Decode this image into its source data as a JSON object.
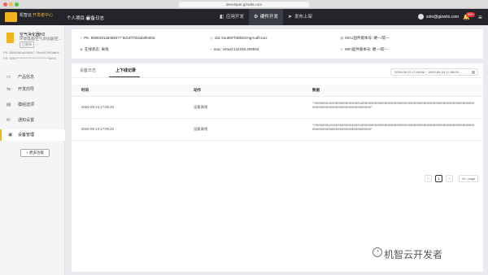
{
  "browser": {
    "url": "developer.gizwits.com"
  },
  "topnav": {
    "logo_text": "机智云",
    "logo_sub": "开发者中心",
    "project": "个人项目 ◉",
    "device_log": "设备日志",
    "tabs": [
      {
        "label": "应用开发",
        "icon": "app-icon"
      },
      {
        "label": "硬件开发",
        "icon": "hardware-icon"
      },
      {
        "label": "发布上架",
        "icon": "publish-icon"
      }
    ],
    "user_email": "sole@gizwits.com",
    "badge": "99+"
  },
  "sidebar": {
    "product_name": "空气净化器H2",
    "product_sub": "环境电器/空气净化器/空...",
    "product_tag": "已发布",
    "pk_label": "PK:",
    "pk_value": "8508481a846847 79cb4f70b3ab0f...",
    "ps_label": "PS:",
    "ps_value": "64f6**************************6e0a",
    "items": [
      {
        "label": "产品信息",
        "icon": "info-icon"
      },
      {
        "label": "开发向导",
        "icon": "guide-icon"
      },
      {
        "label": "模组选项",
        "icon": "module-icon"
      },
      {
        "label": "通知设置",
        "icon": "notify-icon"
      },
      {
        "label": "设备管理",
        "icon": "device-icon"
      }
    ],
    "add_button": "+ 更多功能"
  },
  "info": {
    "pk": "PK: 8508481a8468477 9cb4f70b3ab0fe80a",
    "did": "did: k4u8SFhtDBS2HgAodfccwJ",
    "mcu": "MCU固件版本号: 硬—/软—",
    "status": "在线状态: 离线",
    "mac": "mac: virtual:142335:409940",
    "wifi": "WiFi固件版本号: 硬—/软—"
  },
  "panel": {
    "tabs": [
      "设备日志",
      "上下线记录"
    ],
    "date_range": "2020-09-22 17:08:00 ~ 2020-09-24 17:08:00",
    "headers": [
      "时间",
      "动作",
      "数据"
    ],
    "rows": [
      {
        "time": "2020-09-24 17:06:49",
        "action": "设备离线",
        "data": "\"0000000322000000000400010000000000000000000000003000000000000000000000000000000000000000000000000000000000000000\""
      },
      {
        "time": "2020-09-24 17:06:25",
        "action": "设备离线",
        "data": "\"0000000322000000000400010000000000000000000000003000000000000000000000000000000000000000000000000000000000000000\""
      }
    ],
    "pager": {
      "prev": "<",
      "page": "1",
      "next": ">",
      "size": "20 / page"
    }
  },
  "watermark": "机智云开发者"
}
